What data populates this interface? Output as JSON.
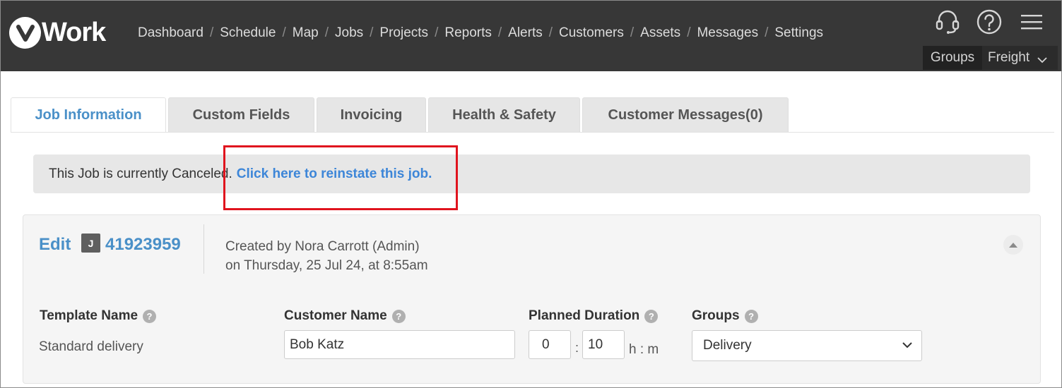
{
  "app": {
    "logo_letter": "v",
    "logo_word": "Work"
  },
  "nav": {
    "items": [
      "Dashboard",
      "Schedule",
      "Map",
      "Jobs",
      "Projects",
      "Reports",
      "Alerts",
      "Customers",
      "Assets",
      "Messages",
      "Settings"
    ],
    "separator": "/"
  },
  "header_icons": [
    "headset-icon",
    "help-circle-icon",
    "hamburger-menu-icon"
  ],
  "groups_bar": {
    "groups_label": "Groups",
    "freight_label": "Freight"
  },
  "tabs": [
    {
      "label": "Job Information",
      "active": true
    },
    {
      "label": "Custom Fields",
      "active": false
    },
    {
      "label": "Invoicing",
      "active": false
    },
    {
      "label": "Health & Safety",
      "active": false
    },
    {
      "label": "Customer Messages(0)",
      "active": false
    }
  ],
  "alert": {
    "text": "This Job is currently Canceled.",
    "link": "Click here to reinstate this job."
  },
  "job": {
    "edit_label": "Edit",
    "badge": "J",
    "number": "41923959",
    "created_line1": "Created by Nora Carrott (Admin)",
    "created_line2": "on Thursday, 25 Jul 24, at 8:55am"
  },
  "fields": {
    "template_name": {
      "label": "Template Name",
      "value": "Standard delivery"
    },
    "customer_name": {
      "label": "Customer Name",
      "value": "Bob Katz"
    },
    "planned_duration": {
      "label": "Planned Duration",
      "hours": "0",
      "minutes": "10",
      "separator": ":",
      "unit": "h : m"
    },
    "groups": {
      "label": "Groups",
      "selected": "Delivery"
    },
    "help_glyph": "?"
  },
  "colors": {
    "topbar": "#373737",
    "accent": "#4a90c8",
    "link": "#3d86d8",
    "highlight": "#e0141e"
  }
}
